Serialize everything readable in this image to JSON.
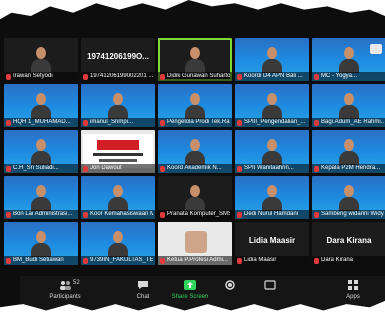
{
  "participants": [
    {
      "name": "Irawan Setyodi",
      "style": "dark"
    },
    {
      "name": "19741206199002201 ...",
      "big": "19741206199O...",
      "style": "dark"
    },
    {
      "name": "Didik Gunawan Suharto",
      "style": "dark",
      "highlight": true
    },
    {
      "name": "Koordi D4 APN Bali ...",
      "style": "blue"
    },
    {
      "name": "MC - Yogya...",
      "style": "blue"
    },
    {
      "name": "HQH 1_MUHAMAD...",
      "style": "blue"
    },
    {
      "name": "imanul_Srimpi...",
      "style": "blue"
    },
    {
      "name": "Pengelola Prodi Tek.Ra...",
      "style": "blue"
    },
    {
      "name": "SPIII_Pengendalian_...",
      "style": "blue"
    },
    {
      "name": "Bagi.Adum_AE Rahmi...",
      "style": "blue"
    },
    {
      "name": "C.H_Sri Suliadi...",
      "style": "blue"
    },
    {
      "name": "Jon Dawout",
      "style": "light",
      "logo": true
    },
    {
      "name": "Koord Akademik N...",
      "style": "blue"
    },
    {
      "name": "SPII Wanitaahrin...",
      "style": "blue"
    },
    {
      "name": "Kepala P2M Hendra...",
      "style": "blue"
    },
    {
      "name": "Bon Lai Administrasi...",
      "style": "blue"
    },
    {
      "name": "Koor Kemahasiswaan Ma...",
      "style": "blue"
    },
    {
      "name": "Pranata Komputer_SMS...",
      "style": "dark"
    },
    {
      "name": "Dedi Nurul Hamdani",
      "style": "blue"
    },
    {
      "name": "Sambeng widarini Widy...",
      "style": "blue"
    },
    {
      "name": "BM_Budi Setiawan",
      "style": "blue"
    },
    {
      "name": "9739IN_FAKULTAS_TEKNIK...",
      "style": "blue"
    },
    {
      "name": "Ketua P.Profesi Admi...",
      "style": "light",
      "avatar": true
    },
    {
      "name": "Lidia Maasir",
      "big": "Lidia Maasir",
      "style": "dark"
    },
    {
      "name": "Dara Kirana",
      "big": "Dara Kirana",
      "style": "dark"
    }
  ],
  "toolbar": [
    {
      "label": "Participants",
      "count": "52",
      "icon": "participants-icon"
    },
    {
      "label": "Chat",
      "icon": "chat-icon"
    },
    {
      "label": "Share Screen",
      "icon": "share-screen-icon",
      "green": true
    },
    {
      "label": "",
      "icon": "record-icon"
    },
    {
      "label": "",
      "icon": "reactions-icon"
    },
    {
      "label": "Apps",
      "icon": "apps-icon"
    }
  ]
}
